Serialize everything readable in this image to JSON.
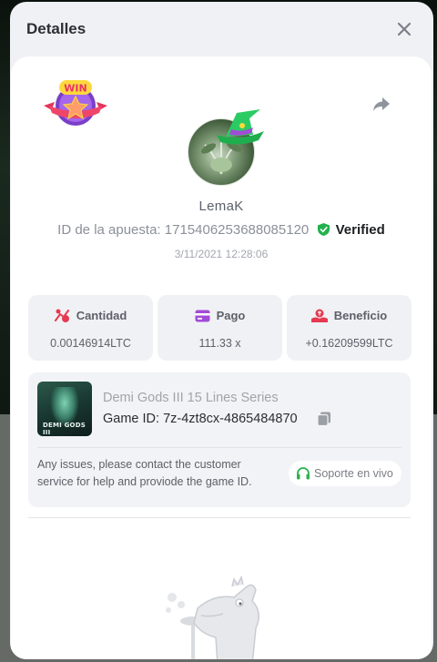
{
  "modal": {
    "title": "Detalles"
  },
  "win_badge": {
    "text": "WIN"
  },
  "player": {
    "username": "LemaK",
    "bet_id_label": "ID de la apuesta:",
    "bet_id": "1715406253688085120",
    "verified_label": "Verified",
    "timestamp": "3/11/2021 12:28:06"
  },
  "stats": [
    {
      "icon": "bet-amount-icon",
      "label": "Cantidad",
      "value": "0.00146914LTC"
    },
    {
      "icon": "card-icon",
      "label": "Pago",
      "value": "111.33 x"
    },
    {
      "icon": "profit-icon",
      "label": "Beneficio",
      "value": "+0.16209599LTC"
    }
  ],
  "game": {
    "thumb_text": "DEMI GODS III",
    "name": "Demi Gods III 15 Lines Series",
    "id_label": "Game ID:",
    "id": "7z-4zt8cx-4865484870",
    "issues_text": "Any issues, please contact the customer service for help and proviode the game ID.",
    "support_label": "Soporte en vivo"
  },
  "colors": {
    "verified_green": "#22b14c",
    "accent_red": "#e7394f",
    "card_purple": "#a24bd6",
    "support_green": "#2bb24c"
  }
}
